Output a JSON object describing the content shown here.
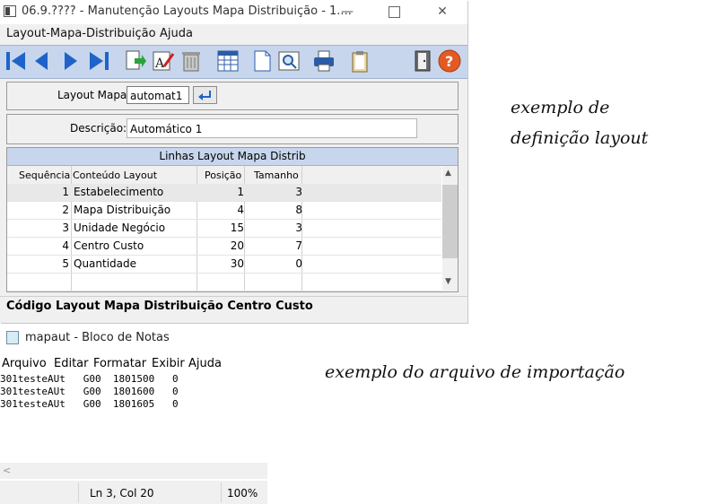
{
  "window": {
    "title": "06.9.???? - Manutenção Layouts Mapa Distribuição - 1....",
    "menu": [
      "Layout-Mapa-Distribuição",
      "Ajuda"
    ]
  },
  "toolbar": {
    "icons": [
      "first-icon",
      "prev-icon",
      "next-icon",
      "last-icon",
      "goto-icon",
      "edit-icon",
      "delete-icon",
      "table-icon",
      "new-document-icon",
      "zoom-icon",
      "print-icon",
      "clipboard-icon",
      "exit-icon",
      "help-icon"
    ]
  },
  "form": {
    "layout_label": "Layout Mapa:",
    "layout_value": "automat1",
    "descricao_label": "Descrição:",
    "descricao_value": "Automático 1"
  },
  "grid": {
    "title": "Linhas Layout Mapa Distrib",
    "columns": [
      "Sequência",
      "Conteúdo Layout",
      "Posição",
      "Tamanho"
    ],
    "rows": [
      {
        "seq": "1",
        "conteudo": "Estabelecimento",
        "posicao": "1",
        "tamanho": "3"
      },
      {
        "seq": "2",
        "conteudo": "Mapa Distribuição",
        "posicao": "4",
        "tamanho": "8"
      },
      {
        "seq": "3",
        "conteudo": "Unidade Negócio",
        "posicao": "15",
        "tamanho": "3"
      },
      {
        "seq": "4",
        "conteudo": "Centro Custo",
        "posicao": "20",
        "tamanho": "7"
      },
      {
        "seq": "5",
        "conteudo": "Quantidade",
        "posicao": "30",
        "tamanho": "0"
      }
    ]
  },
  "status": "Código Layout Mapa Distribuição Centro Custo",
  "notes": {
    "layout_line1": "exemplo de",
    "layout_line2": "definição layout",
    "import": "exemplo do arquivo de importação"
  },
  "notepad": {
    "title": "mapaut - Bloco de Notas",
    "menu": [
      "Arquivo",
      "Editar",
      "Formatar",
      "Exibir",
      "Ajuda"
    ],
    "lines": [
      "301testeAUt   G00  1801500   0",
      "301testeAUt   G00  1801600   0",
      "301testeAUt   G00  1801605   0"
    ],
    "status_position": "Ln 3, Col 20",
    "status_zoom": "100%"
  }
}
